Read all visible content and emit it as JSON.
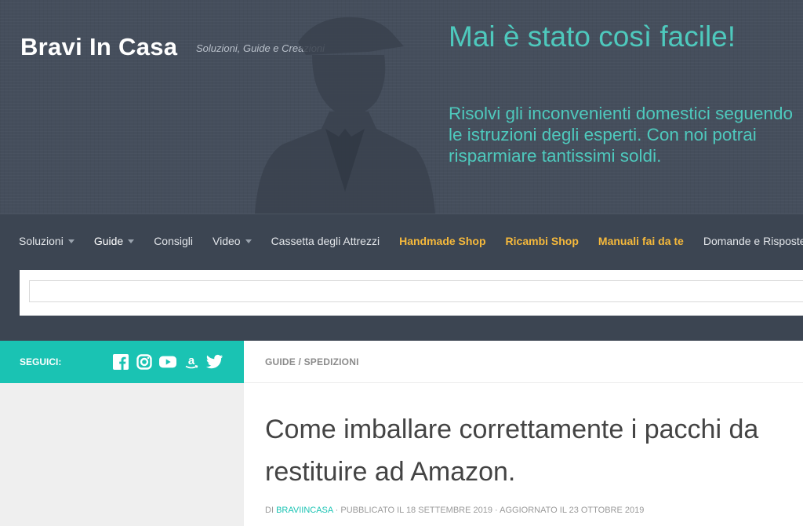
{
  "site": {
    "title": "Bravi In Casa",
    "tagline": "Soluzioni, Guide e Creazioni"
  },
  "banner": {
    "headline": "Mai è stato così facile!",
    "body": "Risolvi gli inconvenienti domestici seguendo le istruzioni degli esperti. Con noi potrai risparmiare tantissimi soldi."
  },
  "nav": {
    "items": [
      {
        "label": "Soluzioni",
        "dropdown": true
      },
      {
        "label": "Guide",
        "dropdown": true
      },
      {
        "label": "Consigli"
      },
      {
        "label": "Video",
        "dropdown": true
      },
      {
        "label": "Cassetta degli Attrezzi"
      },
      {
        "label": "Handmade Shop"
      },
      {
        "label": "Ricambi Shop"
      },
      {
        "label": "Manuali fai da te"
      },
      {
        "label": "Domande e Risposte",
        "dropdown": true
      }
    ]
  },
  "search": {
    "placeholder": ""
  },
  "sidebar": {
    "follow_label": "SEGUICI:",
    "social_icons": [
      "facebook-icon",
      "instagram-icon",
      "youtube-icon",
      "amazon-icon",
      "twitter-icon"
    ]
  },
  "article": {
    "breadcrumb": "GUIDE / SPEDIZIONI",
    "title": "Come imballare correttamente i pacchi da restituire ad Amazon.",
    "meta": {
      "by": "DI",
      "author": "BRAVIINCASA",
      "published": "· PUBBLICATO IL 18 SETTEMBRE 2019 · AGGIORNATO IL 23 OTTOBRE 2019"
    }
  },
  "colors": {
    "header_bg": "#454e5c",
    "nav_bg": "#3c4552",
    "accent": "#1ac3b3",
    "banner_text": "#4ec9bd",
    "highlight_link": "#f6b93b"
  }
}
